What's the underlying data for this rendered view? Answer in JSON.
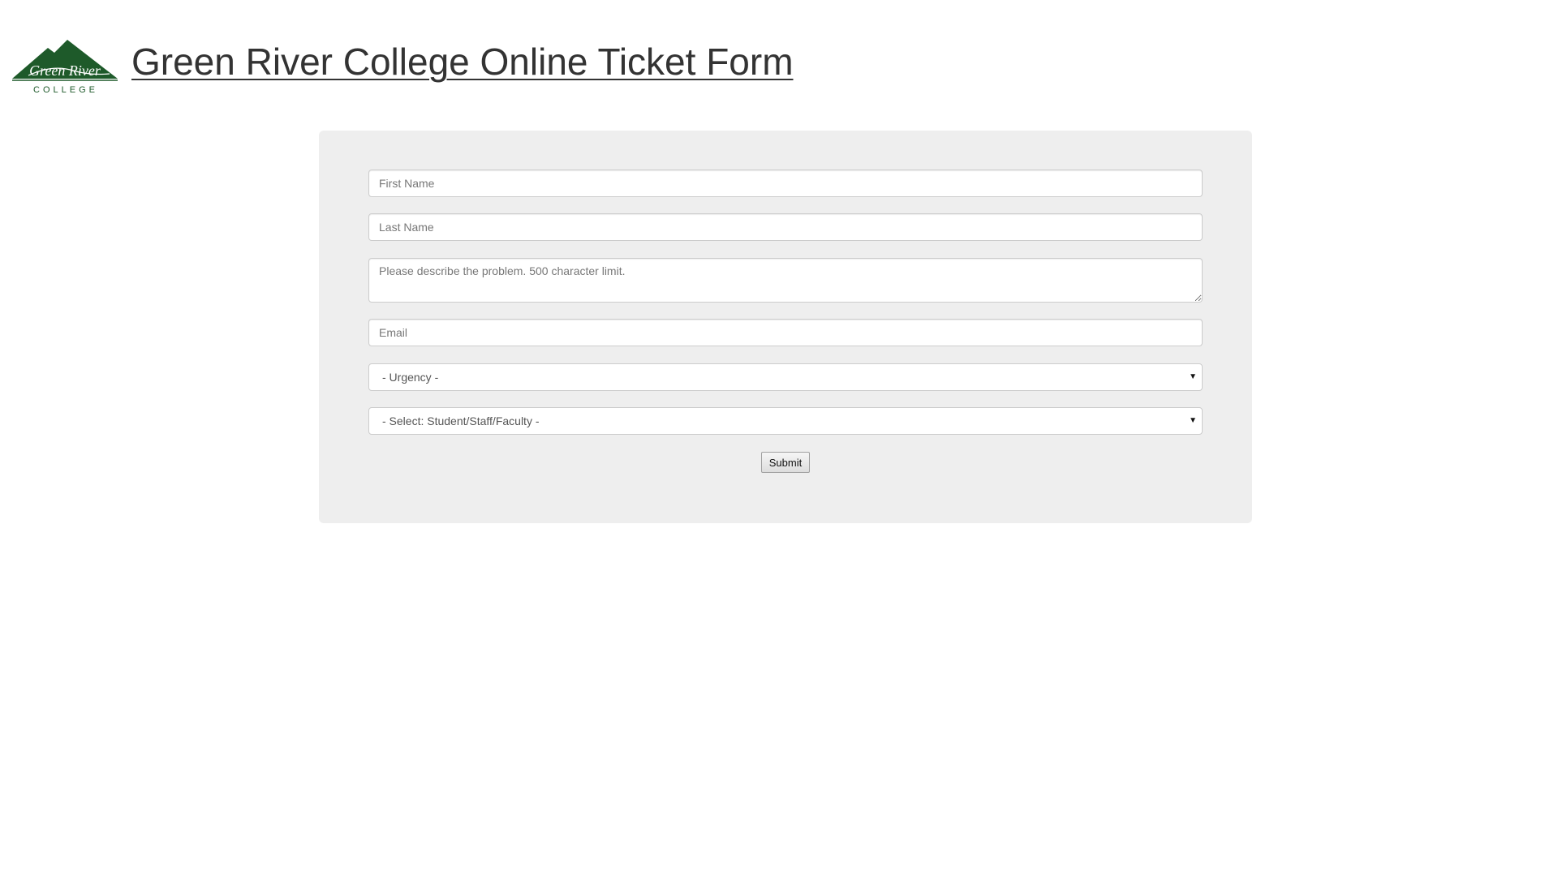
{
  "header": {
    "title": "Green River College Online Ticket Form",
    "logo": {
      "icon": "green-river-college-logo",
      "wordmark": "Green River",
      "subtext": "COLLEGE",
      "color": "#1e5a2a"
    }
  },
  "form": {
    "first_name_placeholder": "First Name",
    "last_name_placeholder": "Last Name",
    "problem_placeholder": "Please describe the problem. 500 character limit.",
    "email_placeholder": "Email",
    "urgency_selected": "- Urgency -",
    "role_selected": "- Select: Student/Staff/Faculty -",
    "submit_label": "Submit"
  },
  "colors": {
    "panel_background": "#eeeeee",
    "title_color": "#333333",
    "brand_green": "#1e5a2a"
  }
}
